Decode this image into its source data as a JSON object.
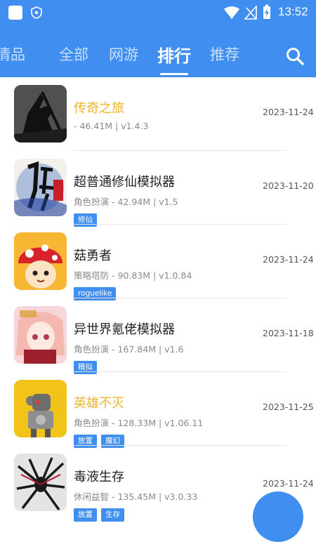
{
  "status_bar": {
    "time": "13:52"
  },
  "tabs": [
    {
      "label": "倩品",
      "active": false
    },
    {
      "label": "全部",
      "active": false
    },
    {
      "label": "网游",
      "active": false
    },
    {
      "label": "排行",
      "active": true
    },
    {
      "label": "推荐",
      "active": false
    }
  ],
  "colors": {
    "accent": "#3f8ef0",
    "highlight_name": "#f0b429"
  },
  "games": [
    {
      "name": "传奇之旅",
      "meta": " - 46.41M | v1.4.3",
      "date": "2023-11-24",
      "tags": [],
      "highlight": true,
      "icon": "warrior-silhouette-icon"
    },
    {
      "name": "超普通修仙模拟器",
      "meta": "角色扮演 - 42.94M | v1.5",
      "date": "2023-11-20",
      "tags": [
        "修仙"
      ],
      "highlight": false,
      "icon": "xiuxian-calligraphy-icon"
    },
    {
      "name": "菇勇者",
      "meta": "策略塔防 - 90.83M | v1.0.84",
      "date": "2023-11-24",
      "tags": [
        "roguelike"
      ],
      "highlight": false,
      "icon": "mushroom-hero-icon"
    },
    {
      "name": "异世界氪佬模拟器",
      "meta": "角色扮演 - 167.84M | v1.6",
      "date": "2023-11-18",
      "tags": [
        "模拟"
      ],
      "highlight": false,
      "icon": "anime-girl-icon"
    },
    {
      "name": "英雄不灭",
      "meta": "角色扮演 - 128.33M | v1.06.11",
      "date": "2023-11-25",
      "tags": [
        "放置",
        "魔幻"
      ],
      "highlight": true,
      "icon": "robot-hero-icon"
    },
    {
      "name": "毒液生存",
      "meta": "休闲益智 - 135.45M | v3.0.33",
      "date": "2023-11-24",
      "tags": [
        "放置",
        "生存"
      ],
      "highlight": false,
      "icon": "venom-spider-icon"
    }
  ]
}
